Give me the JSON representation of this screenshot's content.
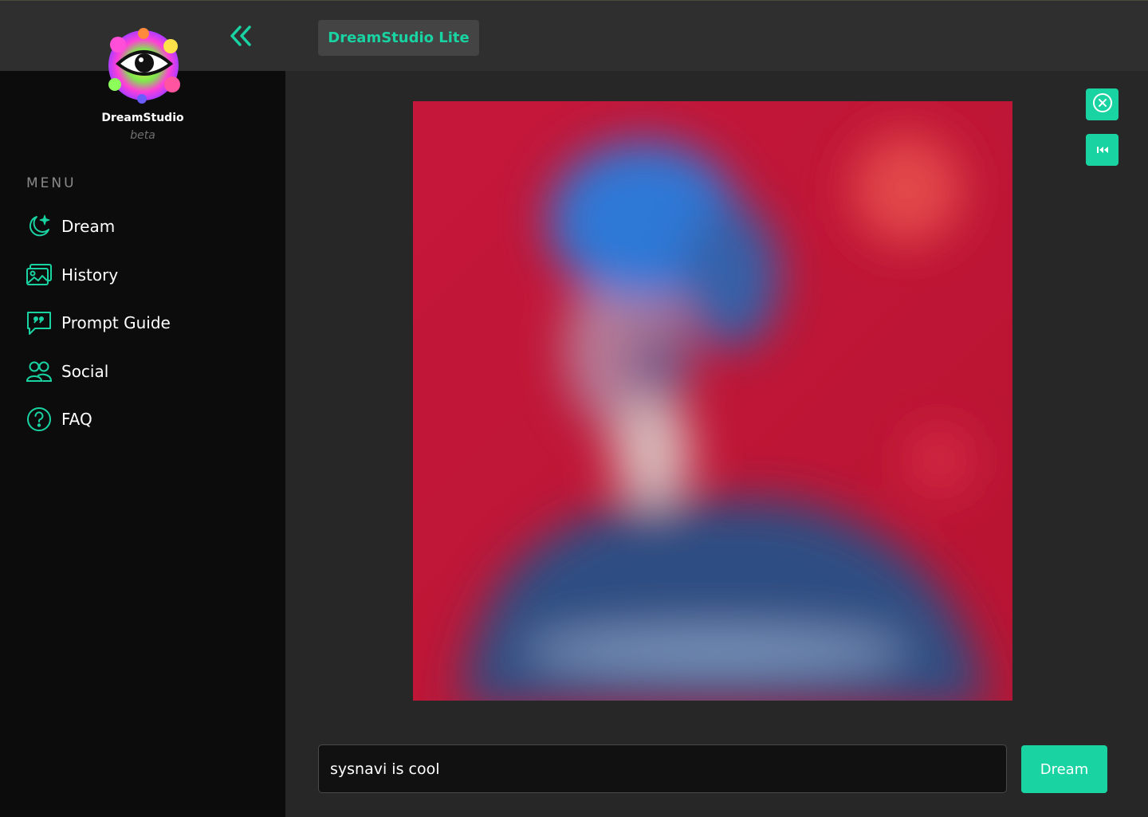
{
  "brand": {
    "name": "DreamStudio",
    "subtitle": "beta"
  },
  "header": {
    "app_tab": "DreamStudio Lite",
    "collapse_icon": "double-chevron-left-icon"
  },
  "sidebar": {
    "heading": "MENU",
    "items": [
      {
        "label": "Dream",
        "icon": "moon-stars-icon"
      },
      {
        "label": "History",
        "icon": "images-icon"
      },
      {
        "label": "Prompt Guide",
        "icon": "quote-bubble-icon"
      },
      {
        "label": "Social",
        "icon": "users-icon"
      },
      {
        "label": "FAQ",
        "icon": "question-circle-icon"
      }
    ]
  },
  "image_panel": {
    "close_icon": "close-circle-icon",
    "rewind_icon": "skip-back-icon"
  },
  "prompt": {
    "value": "sysnavi is cool"
  },
  "actions": {
    "dream_label": "Dream"
  },
  "colors": {
    "accent": "#19d3a2",
    "sidebar_bg": "#0c0c0c",
    "main_bg": "#272727",
    "topbar_bg": "#2f2f2f"
  }
}
